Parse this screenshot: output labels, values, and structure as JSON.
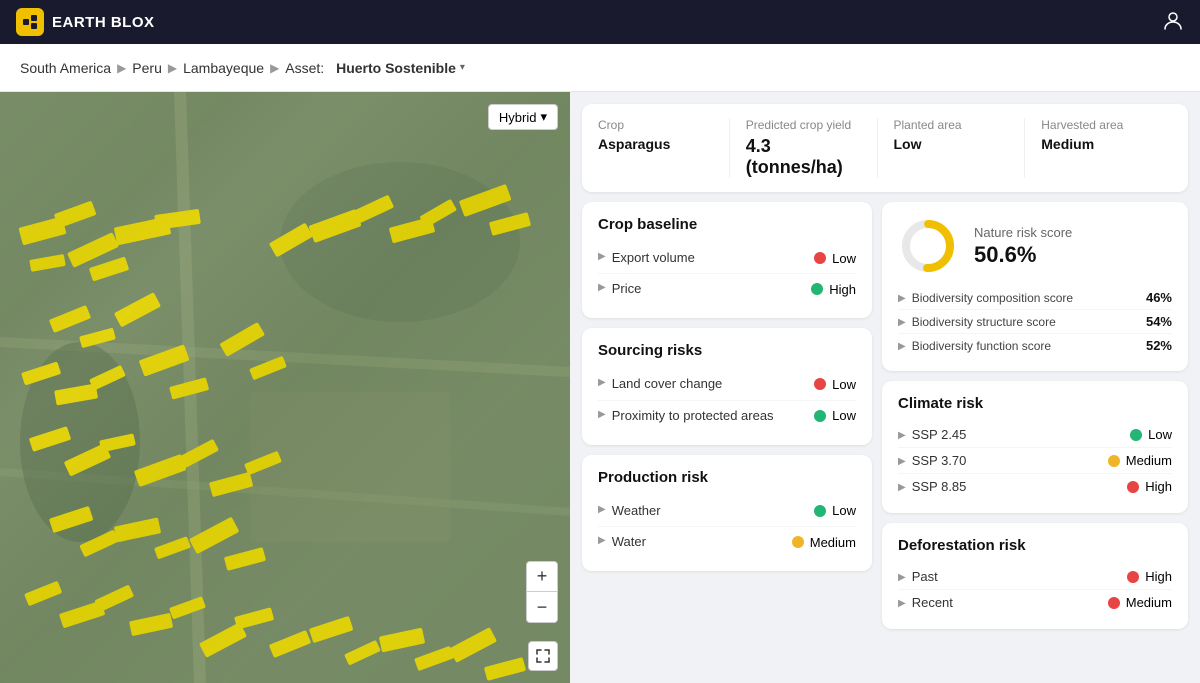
{
  "app": {
    "brand": "EARTH BLOX",
    "brand_icon": "🌍"
  },
  "breadcrumb": {
    "region": "South America",
    "country": "Peru",
    "area": "Lambayeque",
    "asset_label": "Asset:",
    "asset_name": "Huerto Sostenible"
  },
  "map": {
    "type_button": "Hybrid",
    "zoom_in": "+",
    "zoom_out": "−",
    "fullscreen": "⛶"
  },
  "summary": {
    "crop_label": "Crop",
    "crop_value": "Asparagus",
    "yield_label": "Predicted crop yield",
    "yield_value": "4.3 (tonnes/ha)",
    "planted_label": "Planted area",
    "planted_value": "Low",
    "harvested_label": "Harvested area",
    "harvested_value": "Medium"
  },
  "crop_baseline": {
    "title": "Crop baseline",
    "rows": [
      {
        "label": "Export volume",
        "status": "Low",
        "color": "red"
      },
      {
        "label": "Price",
        "status": "High",
        "color": "green"
      }
    ]
  },
  "sourcing_risks": {
    "title": "Sourcing risks",
    "rows": [
      {
        "label": "Land cover change",
        "status": "Low",
        "color": "red"
      },
      {
        "label": "Proximity to protected areas",
        "status": "Low",
        "color": "green"
      }
    ]
  },
  "production_risk": {
    "title": "Production risk",
    "rows": [
      {
        "label": "Weather",
        "status": "Low",
        "color": "green"
      },
      {
        "label": "Water",
        "status": "Medium",
        "color": "yellow"
      }
    ]
  },
  "nature_risk": {
    "title": "Nature risk score",
    "value": "50.6%",
    "donut_value": 50.6,
    "rows": [
      {
        "label": "Biodiversity composition score",
        "pct": "46%"
      },
      {
        "label": "Biodiversity structure score",
        "pct": "54%"
      },
      {
        "label": "Biodiversity function score",
        "pct": "52%"
      }
    ]
  },
  "climate_risk": {
    "title": "Climate risk",
    "rows": [
      {
        "label": "SSP 2.45",
        "status": "Low",
        "color": "green"
      },
      {
        "label": "SSP 3.70",
        "status": "Medium",
        "color": "yellow"
      },
      {
        "label": "SSP 8.85",
        "status": "High",
        "color": "red"
      }
    ]
  },
  "deforestation_risk": {
    "title": "Deforestation risk",
    "rows": [
      {
        "label": "Past",
        "status": "High",
        "color": "red"
      },
      {
        "label": "Recent",
        "status": "Medium",
        "color": "red"
      }
    ]
  }
}
